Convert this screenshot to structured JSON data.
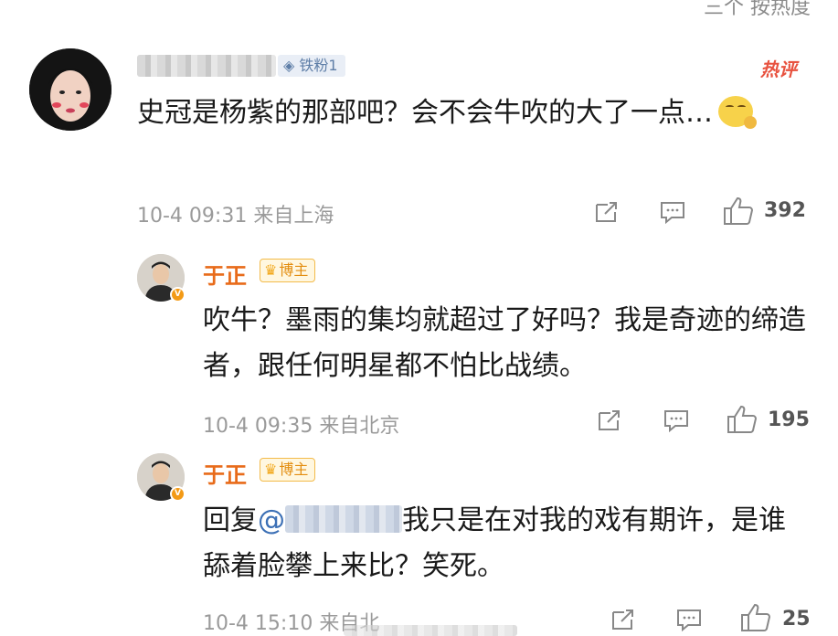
{
  "sort": {
    "label": "三个 按热度"
  },
  "comment": {
    "fan_badge": "铁粉1",
    "hot_tag": "热评",
    "text": "史冠是杨紫的那部吧？会不会牛吹的大了一点…",
    "timestamp": "10-4 09:31",
    "location": "来自上海",
    "likes": "392",
    "replies": [
      {
        "author": "于正",
        "badge": "博主",
        "text": "吹牛？墨雨的集均就超过了好吗？我是奇迹的缔造者，跟任何明星都不怕比战绩。",
        "timestamp": "10-4 09:35",
        "location": "来自北京",
        "likes": "195"
      },
      {
        "author": "于正",
        "badge": "博主",
        "reply_prefix": "回复",
        "mention": "@",
        "text": "我只是在对我的戏有期许，是谁舔着脸攀上来比？笑死。",
        "timestamp": "10-4 15:10",
        "location": "来自北",
        "likes": "25"
      }
    ]
  },
  "colors": {
    "name": "#e86b1a",
    "mention": "#3b6fb5",
    "hot": "#e8523f",
    "meta": "#9a9a9a"
  },
  "icons": [
    "share-icon",
    "comment-icon",
    "like-icon",
    "crown-icon",
    "emoji-thinking-icon"
  ]
}
